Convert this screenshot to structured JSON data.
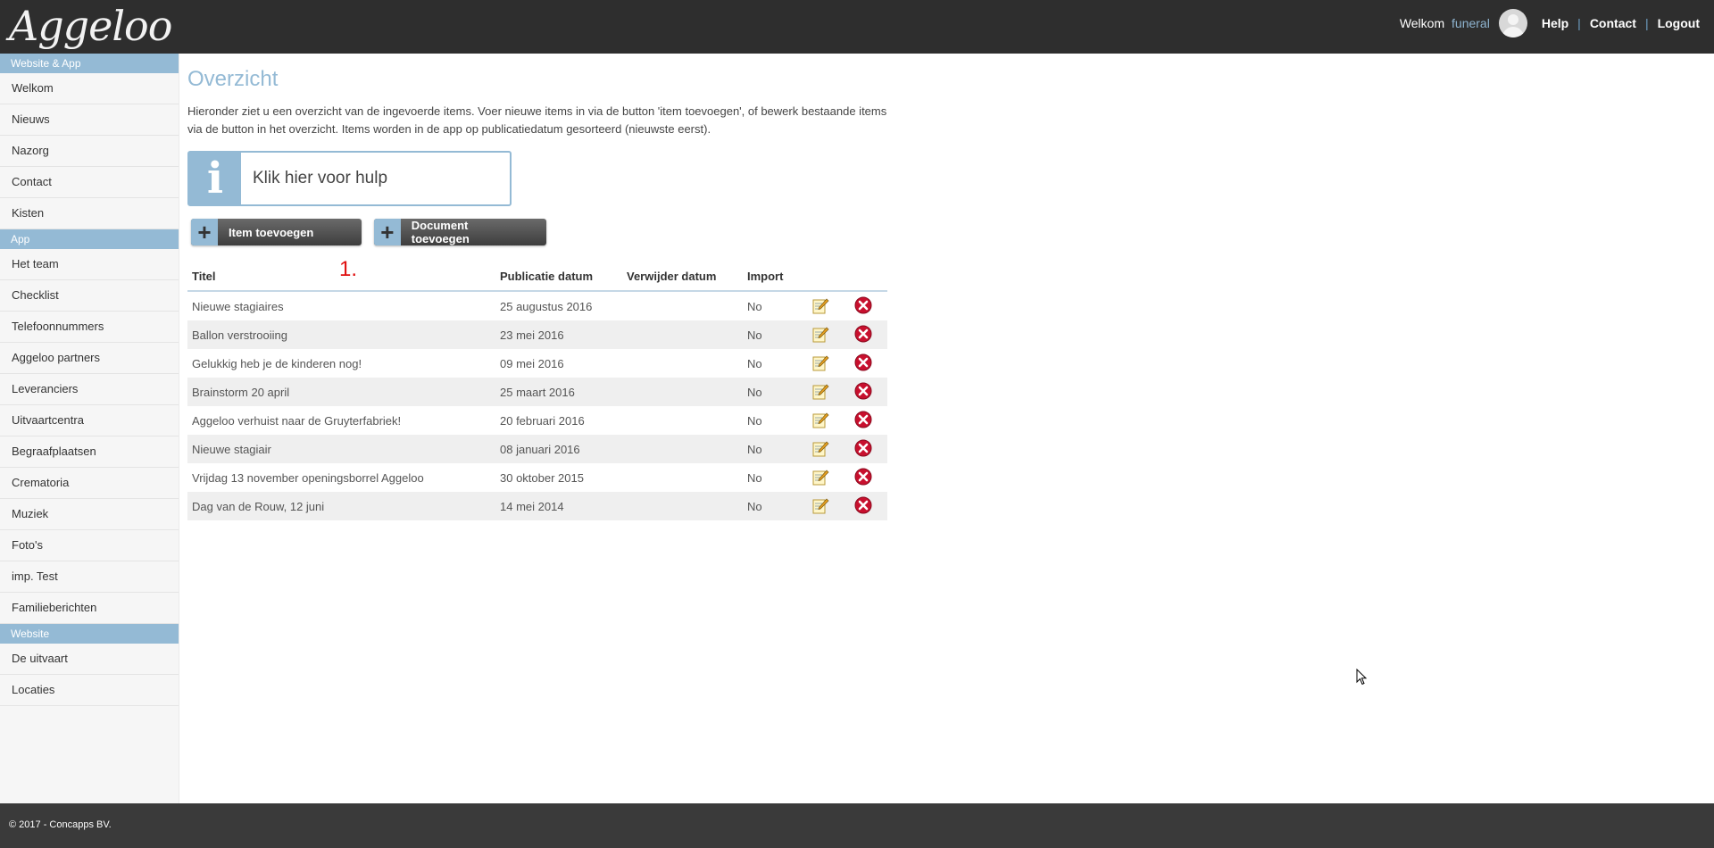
{
  "header": {
    "logo_text": "Aggeloo",
    "welcome_label": "Welkom",
    "username": "funeral",
    "links": [
      "Help",
      "Contact",
      "Logout"
    ]
  },
  "sidebar": {
    "sections": [
      {
        "title": "Website & App",
        "items": [
          "Welkom",
          "Nieuws",
          "Nazorg",
          "Contact",
          "Kisten"
        ]
      },
      {
        "title": "App",
        "items": [
          "Het team",
          "Checklist",
          "Telefoonnummers",
          "Aggeloo partners",
          "Leveranciers",
          "Uitvaartcentra",
          "Begraafplaatsen",
          "Crematoria",
          "Muziek",
          "Foto's",
          "imp. Test",
          "Familieberichten"
        ]
      },
      {
        "title": "Website",
        "items": [
          "De uitvaart",
          "Locaties"
        ]
      }
    ]
  },
  "main": {
    "title": "Overzicht",
    "intro": "Hieronder ziet u een overzicht van de ingevoerde items. Voer nieuwe items in via de button 'item toevoegen', of bewerk bestaande items via de button in het overzicht. Items worden in de app op publicatiedatum gesorteerd (nieuwste eerst).",
    "help_text": "Klik hier voor hulp",
    "help_icon": "info-icon",
    "buttons": {
      "add_item": "Item toevoegen",
      "add_document": "Document toevoegen"
    },
    "annotation": "1.",
    "table": {
      "headers": [
        "Titel",
        "Publicatie datum",
        "Verwijder datum",
        "Import"
      ],
      "rows": [
        {
          "title": "Nieuwe stagiaires",
          "pub": "25 augustus 2016",
          "del": "",
          "import": "No"
        },
        {
          "title": "Ballon verstrooiing",
          "pub": "23 mei 2016",
          "del": "",
          "import": "No"
        },
        {
          "title": "Gelukkig heb je de kinderen nog!",
          "pub": "09 mei 2016",
          "del": "",
          "import": "No"
        },
        {
          "title": "Brainstorm 20 april",
          "pub": "25 maart 2016",
          "del": "",
          "import": "No"
        },
        {
          "title": "Aggeloo verhuist naar de Gruyterfabriek!",
          "pub": "20 februari 2016",
          "del": "",
          "import": "No"
        },
        {
          "title": "Nieuwe stagiair",
          "pub": "08 januari 2016",
          "del": "",
          "import": "No"
        },
        {
          "title": "Vrijdag 13 november openingsborrel Aggeloo",
          "pub": "30 oktober 2015",
          "del": "",
          "import": "No"
        },
        {
          "title": "Dag van de Rouw, 12 juni",
          "pub": "14 mei 2014",
          "del": "",
          "import": "No"
        }
      ]
    }
  },
  "footer": {
    "copyright": "© 2017 - Concapps BV."
  },
  "colors": {
    "accent": "#94bad5",
    "header_bg": "#2e2e2e",
    "footer_bg": "#3a3a3a",
    "delete_red": "#c8102e"
  }
}
